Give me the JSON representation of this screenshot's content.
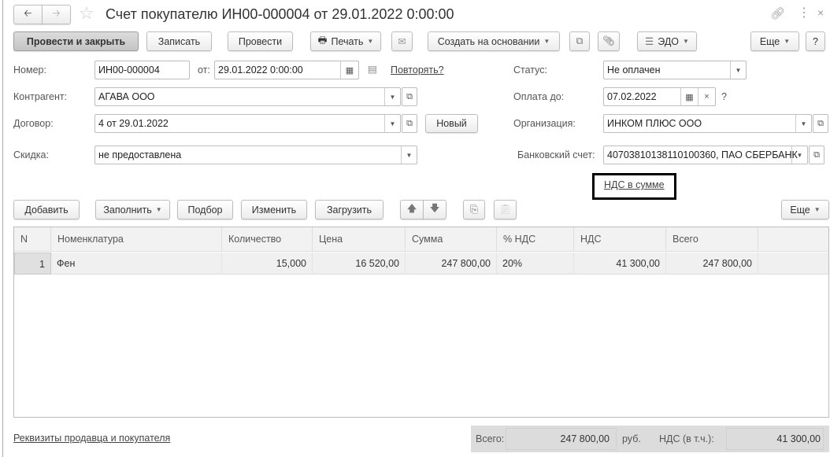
{
  "title": "Счет покупателю ИН00-000004 от 29.01.2022 0:00:00",
  "toolbar": {
    "post_close": "Провести и закрыть",
    "save": "Записать",
    "post": "Провести",
    "print": "Печать",
    "create_based": "Создать на основании",
    "edo": "ЭДО",
    "more": "Еще",
    "help": "?"
  },
  "form": {
    "number_label": "Номер:",
    "number": "ИН00-000004",
    "from_label": "от:",
    "date": "29.01.2022  0:00:00",
    "repeat_link": "Повторять?",
    "status_label": "Статус:",
    "status": "Не оплачен",
    "contractor_label": "Контрагент:",
    "contractor": "АГАВА  ООО",
    "pay_until_label": "Оплата до:",
    "pay_until": "07.02.2022",
    "pay_help": "?",
    "contract_label": "Договор:",
    "contract": "4 от 29.01.2022",
    "new_button": "Новый",
    "org_label": "Организация:",
    "org": "ИНКОМ ПЛЮС ООО",
    "discount_label": "Скидка:",
    "discount": "не предоставлена",
    "bank_label": "Банковский счет:",
    "bank": "40703810138110100360, ПАО СБЕРБАНК",
    "vat_link": "НДС в сумме"
  },
  "table_toolbar": {
    "add": "Добавить",
    "fill": "Заполнить",
    "pick": "Подбор",
    "edit": "Изменить",
    "load": "Загрузить",
    "more": "Еще"
  },
  "table": {
    "columns": [
      "N",
      "Номенклатура",
      "Количество",
      "Цена",
      "Сумма",
      "% НДС",
      "НДС",
      "Всего"
    ],
    "rows": [
      [
        "1",
        "Фен",
        "15,000",
        "16 520,00",
        "247 800,00",
        "20%",
        "41 300,00",
        "247 800,00"
      ]
    ]
  },
  "footer": {
    "details_link": "Реквизиты продавца и покупателя",
    "total_label": "Всего:",
    "total": "247 800,00",
    "currency": "руб.",
    "vat_label": "НДС (в т.ч.):",
    "vat": "41 300,00"
  }
}
